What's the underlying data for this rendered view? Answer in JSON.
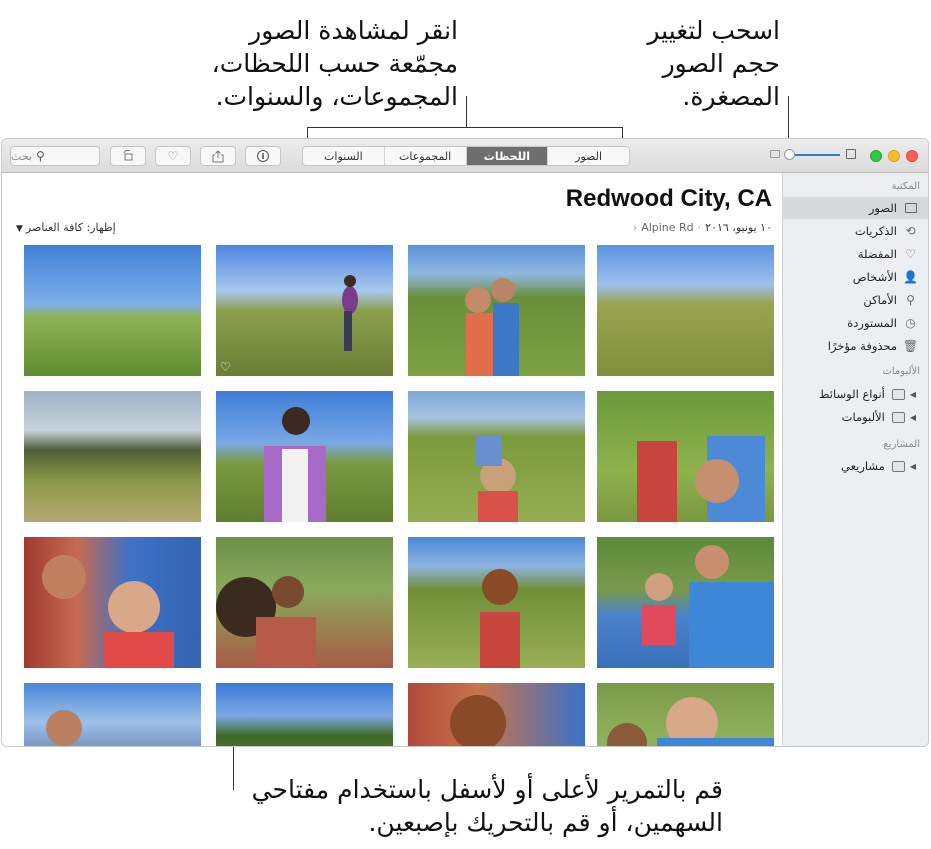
{
  "callouts": {
    "top_center": [
      "انقر لمشاهدة الصور",
      "مجمّعة حسب اللحظات،",
      "المجموعات، والسنوات."
    ],
    "top_right": [
      "اسحب لتغيير",
      "حجم الصور",
      "المصغرة."
    ],
    "bottom": [
      "قم بالتمرير لأعلى أو لأسفل باستخدام مفتاحي",
      "السهمين، أو قم بالتحريك بإصبعين."
    ]
  },
  "toolbar": {
    "search_placeholder": "بحث",
    "search_icon": "magnifier-icon",
    "buttons": [
      "rotate-icon",
      "heart-icon",
      "share-icon",
      "info-icon"
    ],
    "tabs": [
      "الصور",
      "اللحظات",
      "المجموعات",
      "السنوات"
    ],
    "active_tab": "اللحظات",
    "thumbnail_size_level": 0.05
  },
  "traffic_lights": [
    "#2ec845",
    "#f7bc2d",
    "#fc5f57"
  ],
  "sidebar": {
    "library_header": "المكتبة",
    "library_items": [
      {
        "label": "الصور",
        "icon": "photos-icon",
        "active": true
      },
      {
        "label": "الذكريات",
        "icon": "memories-icon"
      },
      {
        "label": "المفضلة",
        "icon": "heart-icon"
      },
      {
        "label": "الأشخاص",
        "icon": "person-icon"
      },
      {
        "label": "الأماكن",
        "icon": "pin-icon"
      },
      {
        "label": "المستوردة",
        "icon": "clock-icon"
      },
      {
        "label": "محذوفة مؤخرًا",
        "icon": "trash-icon"
      }
    ],
    "albums_header": "الألبومات",
    "album_items": [
      {
        "label": "أنواع الوسائط",
        "icon": "folder-icon"
      },
      {
        "label": "الألبومات",
        "icon": "folder-icon"
      }
    ],
    "projects_header": "المشاريع",
    "project_items": [
      {
        "label": "مشاريعي",
        "icon": "folder-icon"
      }
    ]
  },
  "main": {
    "title": "Redwood City, CA",
    "date": "١٠ يونيو، ٢٠١٦",
    "location": "Alpine Rd",
    "show_label": "إظهار: كافة العناصر"
  }
}
